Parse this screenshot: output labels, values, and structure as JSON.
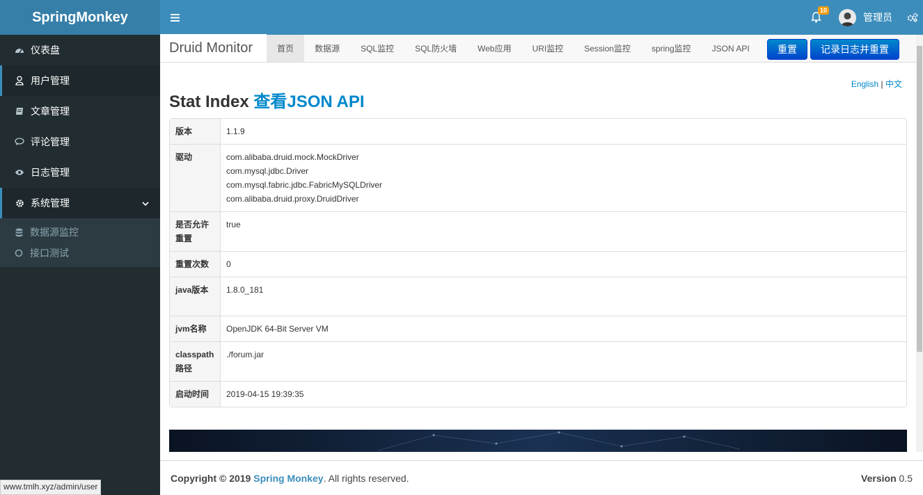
{
  "app": {
    "logo": "SpringMonkey"
  },
  "header": {
    "notification_count": "10",
    "user_name": "管理员"
  },
  "sidebar": {
    "items": [
      {
        "label": "仪表盘",
        "icon": "dashboard-icon"
      },
      {
        "label": "用户管理",
        "icon": "user-icon"
      },
      {
        "label": "文章管理",
        "icon": "book-icon"
      },
      {
        "label": "评论管理",
        "icon": "comment-icon"
      },
      {
        "label": "日志管理",
        "icon": "eye-icon"
      },
      {
        "label": "系统管理",
        "icon": "gear-icon"
      }
    ],
    "subitems": [
      {
        "label": "数据源监控",
        "icon": "database-icon"
      },
      {
        "label": "接口测试",
        "icon": "circle-icon"
      }
    ]
  },
  "druid": {
    "brand": "Druid Monitor",
    "tabs": [
      "首页",
      "数据源",
      "SQL监控",
      "SQL防火墙",
      "Web应用",
      "URI监控",
      "Session监控",
      "spring监控",
      "JSON API"
    ],
    "reset_label": "重置",
    "log_reset_label": "记录日志并重置",
    "lang_en": "English",
    "lang_sep": "|",
    "lang_zh": "中文",
    "title_prefix": "Stat Index",
    "title_link": "查看JSON API"
  },
  "stats": {
    "rows": [
      {
        "key": "版本",
        "value": [
          "1.1.9"
        ]
      },
      {
        "key": "驱动",
        "value": [
          "com.alibaba.druid.mock.MockDriver",
          "com.mysql.jdbc.Driver",
          "com.mysql.fabric.jdbc.FabricMySQLDriver",
          "com.alibaba.druid.proxy.DruidDriver"
        ]
      },
      {
        "key": "是否允许重置",
        "value": [
          "true"
        ]
      },
      {
        "key": "重置次数",
        "value": [
          "0"
        ]
      },
      {
        "key": "java版本",
        "value": [
          "1.8.0_181"
        ]
      },
      {
        "key": "jvm名称",
        "value": [
          "OpenJDK 64-Bit Server VM"
        ]
      },
      {
        "key": "classpath路径",
        "value": [
          "./forum.jar"
        ]
      },
      {
        "key": "启动时间",
        "value": [
          "2019-04-15 19:39:35"
        ]
      }
    ]
  },
  "footer": {
    "copyright": "Copyright © 2019",
    "brand": "Spring Monkey",
    "suffix": ". All rights reserved.",
    "version_label": "Version",
    "version_value": "0.5"
  },
  "statusbar": {
    "url": "www.tmlh.xyz/admin/user"
  }
}
